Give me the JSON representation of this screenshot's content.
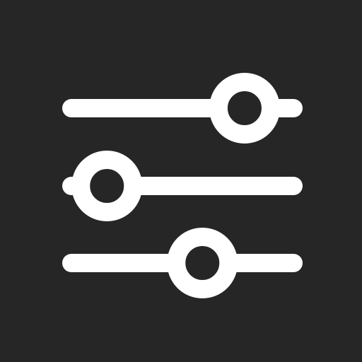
{
  "icon": {
    "name": "sliders-icon",
    "background_color": "#262626",
    "foreground_color": "#ffffff"
  },
  "sliders": [
    {
      "name": "slider-top",
      "level": 0.78
    },
    {
      "name": "slider-middle",
      "level": 0.16
    },
    {
      "name": "slider-bottom",
      "level": 0.59
    }
  ]
}
